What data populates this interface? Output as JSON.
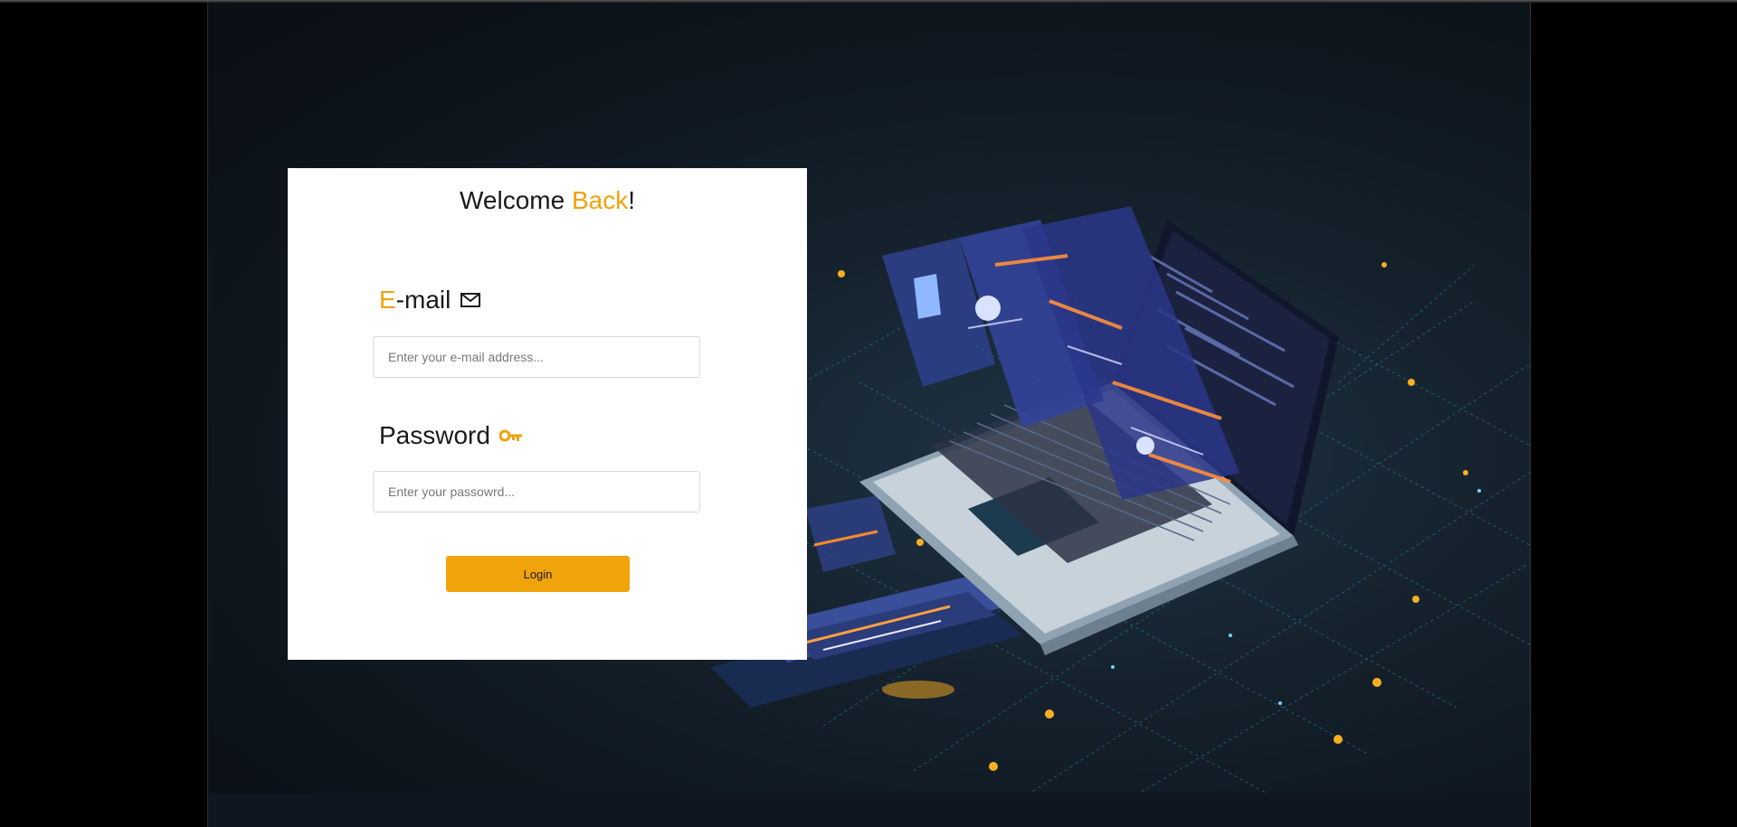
{
  "colors": {
    "accent": "#f0a30a",
    "card_bg": "#ffffff",
    "page_bg": "#000000",
    "stage_bg": "#121b24"
  },
  "login": {
    "title_prefix": "Welcome ",
    "title_accent": "Back",
    "title_suffix": "!",
    "email_label_accent": "E",
    "email_label_rest": "-mail",
    "email_icon": "envelope-icon",
    "email_placeholder": "Enter your e-mail address...",
    "password_label": "Password",
    "password_icon": "key-icon",
    "password_placeholder": "Enter your passowrd...",
    "login_button": "Login"
  },
  "hero_image": "laptop-isometric-illustration"
}
